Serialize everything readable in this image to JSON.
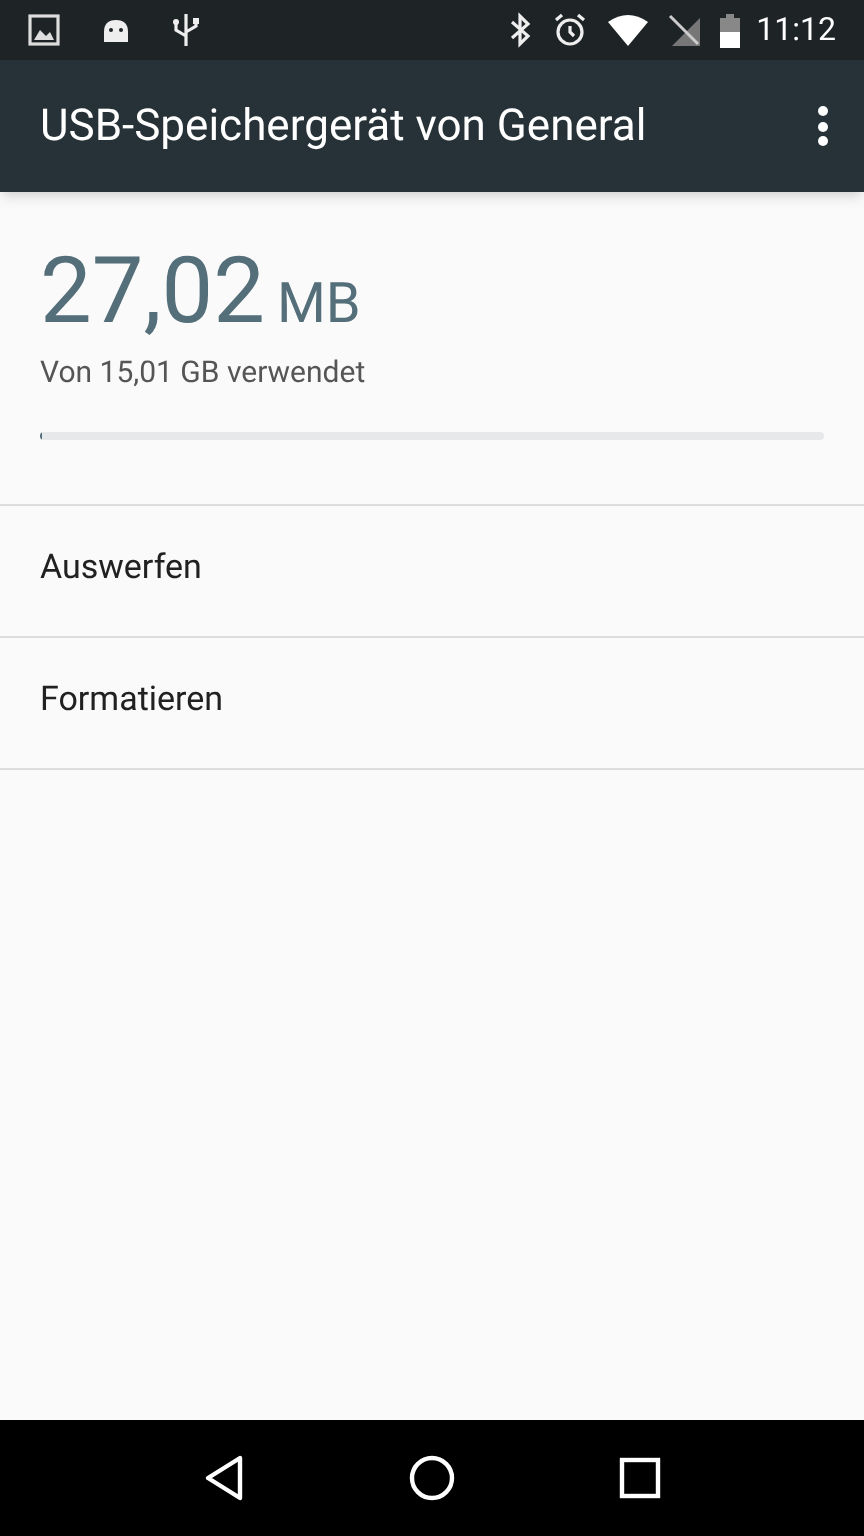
{
  "status_bar": {
    "time": "11:12"
  },
  "app_bar": {
    "title": "USB-Speichergerät von General"
  },
  "storage": {
    "amount": "27,02",
    "unit": "MB",
    "caption": "Von 15,01 GB verwendet",
    "level": 0.002
  },
  "actions": [
    {
      "label": "Auswerfen"
    },
    {
      "label": "Formatieren"
    }
  ]
}
